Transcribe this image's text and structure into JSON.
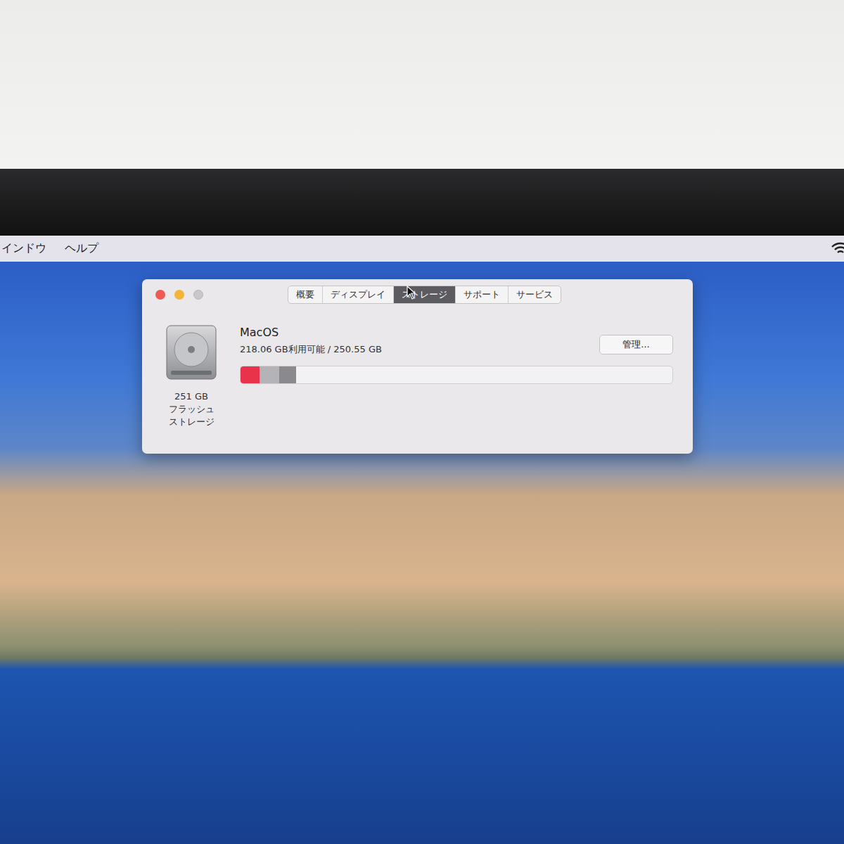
{
  "menu_bar": {
    "items": [
      {
        "label": "インドウ"
      },
      {
        "label": "ヘルプ"
      }
    ]
  },
  "window": {
    "controls": [
      {
        "kind": "close",
        "disabled": false,
        "color": "#ee5a52"
      },
      {
        "kind": "minimize",
        "disabled": false,
        "color": "#f2b53a"
      },
      {
        "kind": "zoom",
        "disabled": true,
        "color": "#c9c7c8"
      }
    ],
    "tabs": [
      {
        "label": "概要",
        "selected": false
      },
      {
        "label": "ディスプレイ",
        "selected": false
      },
      {
        "label": "ストレージ",
        "selected": true
      },
      {
        "label": "サポート",
        "selected": false
      },
      {
        "label": "サービス",
        "selected": false
      }
    ]
  },
  "disk": {
    "name": "MacOS",
    "usage": "218.06 GB利用可能 / 250.55 GB",
    "capacity": "251 GB",
    "type_lines": [
      "フラッシュ",
      "ストレージ"
    ],
    "manage_button": "管理...",
    "segments": [
      {
        "level": 0.044,
        "color": "#e8334a"
      },
      {
        "level": 0.045,
        "color": "#b4b3b7"
      },
      {
        "level": 0.039,
        "color": "#8a898e"
      }
    ]
  }
}
